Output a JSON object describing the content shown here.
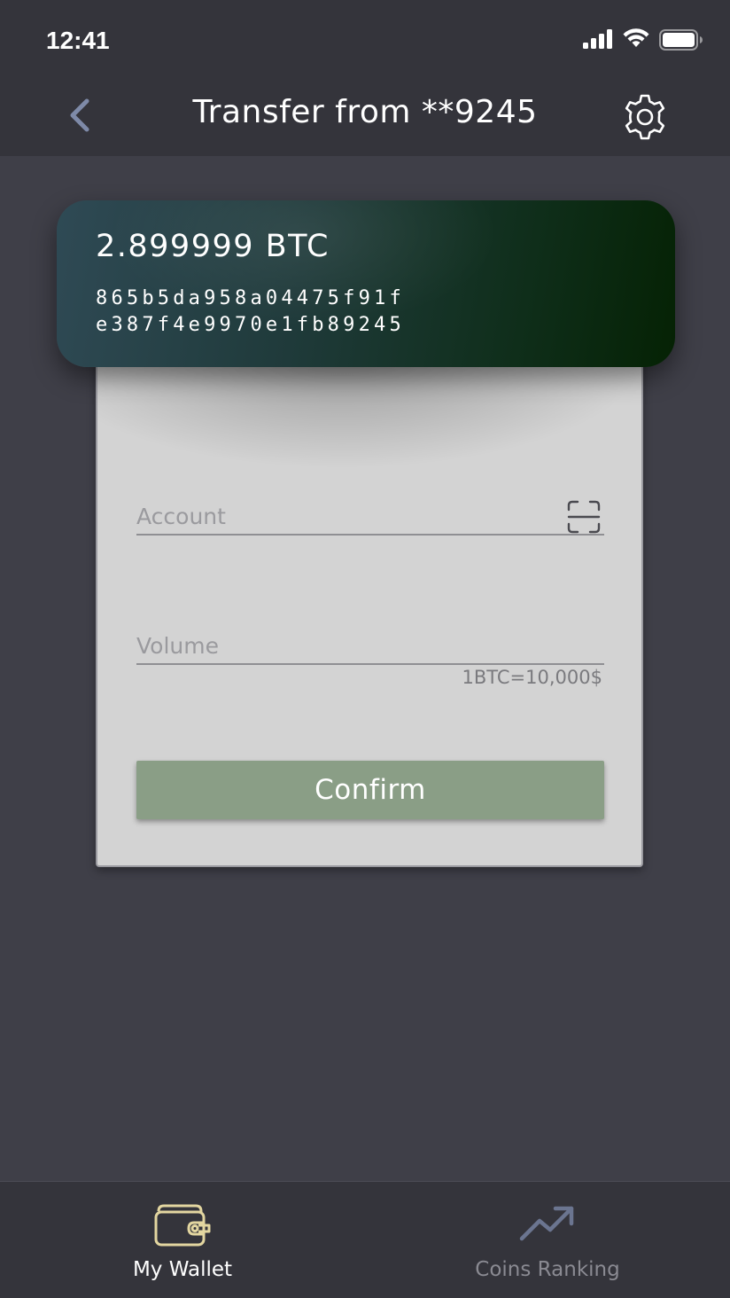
{
  "status_bar": {
    "time": "12:41"
  },
  "header": {
    "title": "Transfer from **9245",
    "back_icon": "chevron-left-icon",
    "settings_icon": "gear-icon"
  },
  "wallet_card": {
    "balance": "2.899999 BTC",
    "address_line1": "865b5da958a04475f91f",
    "address_line2": "e387f4e9970e1fb89245"
  },
  "form": {
    "account_placeholder": "Account",
    "account_value": "",
    "scan_icon": "scan-qr-icon",
    "volume_placeholder": "Volume",
    "volume_value": "",
    "rate_note": "1BTC=10,000$",
    "confirm_label": "Confirm"
  },
  "tab_bar": {
    "tabs": [
      {
        "label": "My Wallet",
        "icon": "wallet-icon",
        "active": true
      },
      {
        "label": "Coins Ranking",
        "icon": "trending-up-icon",
        "active": false
      }
    ]
  },
  "colors": {
    "background": "#3f3f48",
    "bar": "#34343b",
    "confirm_button": "#8a9e86",
    "active_tab_icon": "#e3d6a0",
    "inactive_tab_icon": "#6b7590",
    "back_chevron": "#7e8aa8"
  }
}
